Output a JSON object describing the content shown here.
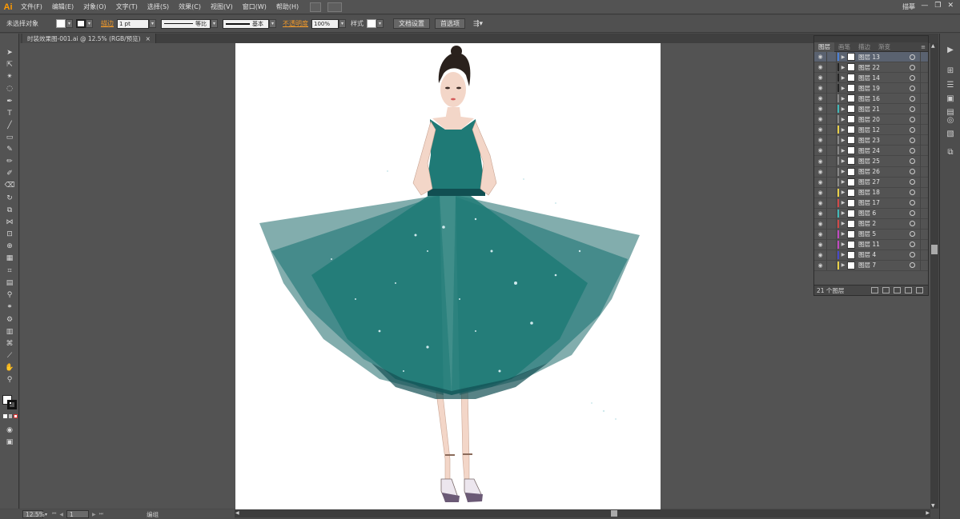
{
  "app": {
    "logo": "Ai",
    "workspace": "描摹",
    "window_controls": [
      "—",
      "❐",
      "✕"
    ]
  },
  "menu": {
    "items": [
      "文件(F)",
      "编辑(E)",
      "对象(O)",
      "文字(T)",
      "选择(S)",
      "效果(C)",
      "视图(V)",
      "窗口(W)",
      "帮助(H)"
    ]
  },
  "controlbar": {
    "selection_status": "未选择对象",
    "stroke_label": "描边",
    "stroke_weight": "1 pt",
    "stroke_profile": "等比",
    "brush_label": "基本",
    "opacity_label": "不透明度",
    "opacity_value": "100%",
    "style_label": "样式",
    "doc_setup_button": "文档设置",
    "preferences_button": "首选项"
  },
  "document_tab": {
    "title": "时装效果图-001.ai @ 12.5% (RGB/预览)",
    "close": "×"
  },
  "layers_panel": {
    "tabs": [
      "图层",
      "画笔",
      "描边",
      "渐变"
    ],
    "active_tab": 0,
    "menu_icon": "≡",
    "layers": [
      {
        "name": "图层 13",
        "color": "#4a7fd4",
        "selected": true
      },
      {
        "name": "图层 22",
        "color": "#222222",
        "selected": false
      },
      {
        "name": "图层 14",
        "color": "#222222",
        "selected": false
      },
      {
        "name": "图层 19",
        "color": "#222222",
        "selected": false
      },
      {
        "name": "图层 16",
        "color": "#888888",
        "selected": false
      },
      {
        "name": "图层 21",
        "color": "#3fb8b8",
        "selected": false
      },
      {
        "name": "图层 20",
        "color": "#888888",
        "selected": false
      },
      {
        "name": "图层 12",
        "color": "#e8d048",
        "selected": false
      },
      {
        "name": "图层 23",
        "color": "#888888",
        "selected": false
      },
      {
        "name": "图层 24",
        "color": "#888888",
        "selected": false
      },
      {
        "name": "图层 25",
        "color": "#888888",
        "selected": false
      },
      {
        "name": "图层 26",
        "color": "#888888",
        "selected": false
      },
      {
        "name": "图层 27",
        "color": "#888888",
        "selected": false
      },
      {
        "name": "图层 18",
        "color": "#e8d048",
        "selected": false
      },
      {
        "name": "图层 17",
        "color": "#d04848",
        "selected": false
      },
      {
        "name": "图层 6",
        "color": "#3fb8b8",
        "selected": false
      },
      {
        "name": "图层 2",
        "color": "#d04848",
        "selected": false
      },
      {
        "name": "图层 5",
        "color": "#c048c0",
        "selected": false
      },
      {
        "name": "图层 11",
        "color": "#c048c0",
        "selected": false
      },
      {
        "name": "图层 4",
        "color": "#4848c8",
        "selected": false
      },
      {
        "name": "图层 7",
        "color": "#e8d048",
        "selected": false
      }
    ],
    "footer_count": "21 个图层"
  },
  "statusbar": {
    "zoom": "12.5%",
    "artboard_number": "1",
    "status_label": "编组"
  },
  "colors": {
    "dress_teal": "#1f7a76",
    "dress_dark": "#114f52",
    "skin": "#f3d6c8",
    "hair": "#2a211d"
  }
}
